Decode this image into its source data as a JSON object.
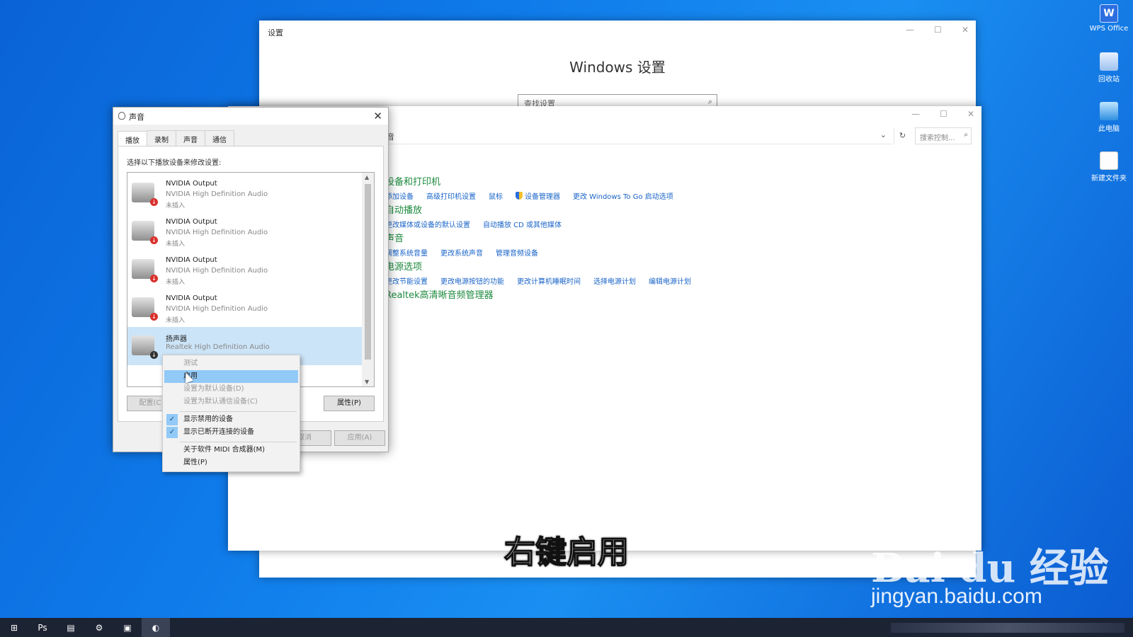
{
  "desktop": {
    "icons": [
      {
        "label": "WPS Office",
        "icon": "wps-office-icon"
      },
      {
        "label": "回收站",
        "icon": "recycle-bin-icon"
      },
      {
        "label": "此电脑",
        "icon": "this-pc-icon"
      },
      {
        "label": "新建文件夹",
        "icon": "folder-icon"
      }
    ]
  },
  "settings_window": {
    "title": "设置",
    "heading": "Windows 设置",
    "search_placeholder": "查找设置"
  },
  "control_panel": {
    "address": "音",
    "search_placeholder": "搜索控制...",
    "sections": [
      {
        "title": "设备和打印机",
        "links": [
          "添加设备",
          "高级打印机设置",
          "鼠标",
          "设备管理器",
          "更改 Windows To Go 启动选项"
        ]
      },
      {
        "title": "自动播放",
        "links": [
          "更改媒体或设备的默认设置",
          "自动播放 CD 或其他媒体"
        ]
      },
      {
        "title": "声音",
        "links": [
          "调整系统音量",
          "更改系统声音",
          "管理音频设备"
        ]
      },
      {
        "title": "电源选项",
        "links": [
          "更改节能设置",
          "更改电源按钮的功能",
          "更改计算机睡眠时间",
          "选择电源计划",
          "编辑电源计划"
        ]
      },
      {
        "title": "Realtek高清晰音频管理器",
        "links": []
      }
    ]
  },
  "sound_dialog": {
    "title": "声音",
    "tabs": [
      "播放",
      "录制",
      "声音",
      "通信"
    ],
    "active_tab": "播放",
    "prompt": "选择以下播放设备来修改设置:",
    "devices": [
      {
        "name": "NVIDIA Output",
        "driver": "NVIDIA High Definition Audio",
        "status": "未插入"
      },
      {
        "name": "NVIDIA Output",
        "driver": "NVIDIA High Definition Audio",
        "status": "未插入"
      },
      {
        "name": "NVIDIA Output",
        "driver": "NVIDIA High Definition Audio",
        "status": "未插入"
      },
      {
        "name": "NVIDIA Output",
        "driver": "NVIDIA High Definition Audio",
        "status": "未插入"
      },
      {
        "name": "扬声器",
        "driver": "Realtek High Definition Audio",
        "status": ""
      }
    ],
    "buttons": {
      "configure": "配置(C",
      "properties": "属性(P)",
      "cancel": "取消",
      "apply": "应用(A)"
    }
  },
  "context_menu": {
    "items": [
      {
        "label": "测试",
        "state": "disabled"
      },
      {
        "label": "启用",
        "state": "highlighted"
      },
      {
        "label": "设置为默认设备(D)",
        "state": "disabled"
      },
      {
        "label": "设置为默认通信设备(C)",
        "state": "disabled"
      },
      {
        "label": "显示禁用的设备",
        "state": "checked"
      },
      {
        "label": "显示已断开连接的设备",
        "state": "checked"
      },
      {
        "label": "关于软件 MIDI 合成器(M)",
        "state": "normal"
      },
      {
        "label": "属性(P)",
        "state": "normal"
      }
    ]
  },
  "subtitle": "右键启用",
  "watermark": {
    "logo": "Bai du 经验",
    "url": "jingyan.baidu.com"
  },
  "taskbar": {
    "icons": [
      "windows-start-icon",
      "photoshop-icon",
      "file-explorer-icon",
      "settings-gear-icon",
      "control-panel-icon",
      "sound-icon"
    ]
  }
}
